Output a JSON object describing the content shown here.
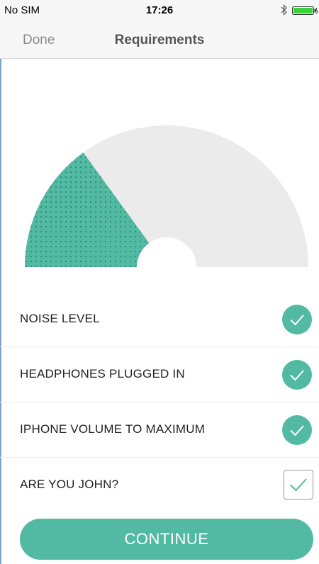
{
  "status_bar": {
    "carrier": "No SIM",
    "time": "17:26",
    "icons": [
      "bluetooth-icon",
      "battery-icon"
    ]
  },
  "nav": {
    "done_label": "Done",
    "title": "Requirements"
  },
  "gauge": {
    "fill_fraction": 0.3,
    "colors": {
      "fill": "#52b9a3",
      "track": "#ebebeb",
      "dots": "#2f8a75"
    }
  },
  "requirements": [
    {
      "label": "NOISE LEVEL",
      "status": "checked",
      "icon": "check-circle-icon"
    },
    {
      "label": "HEADPHONES PLUGGED IN",
      "status": "checked",
      "icon": "check-circle-icon"
    },
    {
      "label": "IPHONE VOLUME TO MAXIMUM",
      "status": "checked",
      "icon": "check-circle-icon"
    },
    {
      "label": "ARE YOU JOHN?",
      "status": "checked",
      "icon": "checkbox-icon"
    }
  ],
  "continue_label": "CONTINUE",
  "colors": {
    "accent": "#52b9a3",
    "nav_background": "#f7f7f7",
    "done_text": "#8a8a8a"
  }
}
